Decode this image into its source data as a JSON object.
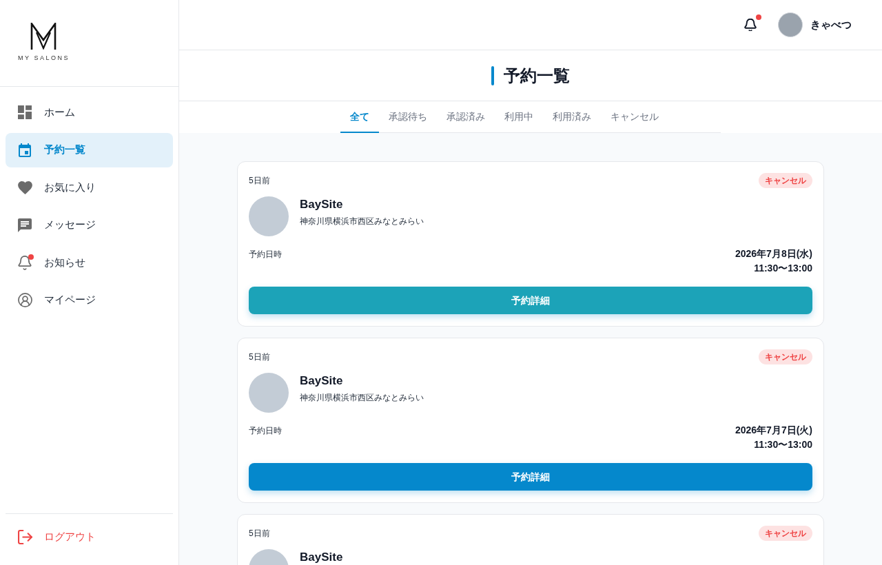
{
  "logo": {
    "text": "MY SALONS"
  },
  "sidebar": {
    "items": [
      {
        "label": "ホーム",
        "selected": false,
        "unread": false
      },
      {
        "label": "予約一覧",
        "selected": true,
        "unread": false
      },
      {
        "label": "お気に入り",
        "selected": false,
        "unread": false
      },
      {
        "label": "メッセージ",
        "selected": false,
        "unread": false
      },
      {
        "label": "お知らせ",
        "selected": false,
        "unread": true
      },
      {
        "label": "マイページ",
        "selected": false,
        "unread": false
      }
    ],
    "logout": {
      "label": "ログアウト"
    }
  },
  "header": {
    "notifications": {
      "unread": true
    },
    "user": {
      "name": "きゃべつ"
    }
  },
  "page_title": "予約一覧",
  "tabs": [
    {
      "label": "全て",
      "selected": true
    },
    {
      "label": "承認待ち",
      "selected": false
    },
    {
      "label": "承認済み",
      "selected": false
    },
    {
      "label": "利用中",
      "selected": false
    },
    {
      "label": "利用済み",
      "selected": false
    },
    {
      "label": "キャンセル",
      "selected": false
    }
  ],
  "reservations": [
    {
      "time_ago": "5日前",
      "status": "キャンセル",
      "name": "BaySite",
      "address": "神奈川県横浜市西区みなとみらい",
      "date_label": "予約日時",
      "date": "2026年7月8日(水)",
      "time": "11:30〜13:00",
      "button": {
        "label": "予約詳細",
        "hovered": true
      }
    },
    {
      "time_ago": "5日前",
      "status": "キャンセル",
      "name": "BaySite",
      "address": "神奈川県横浜市西区みなとみらい",
      "date_label": "予約日時",
      "date": "2026年7月7日(火)",
      "time": "11:30〜13:00",
      "button": {
        "label": "予約詳細",
        "hovered": false
      }
    },
    {
      "time_ago": "5日前",
      "status": "キャンセル",
      "name": "BaySite"
    }
  ]
}
